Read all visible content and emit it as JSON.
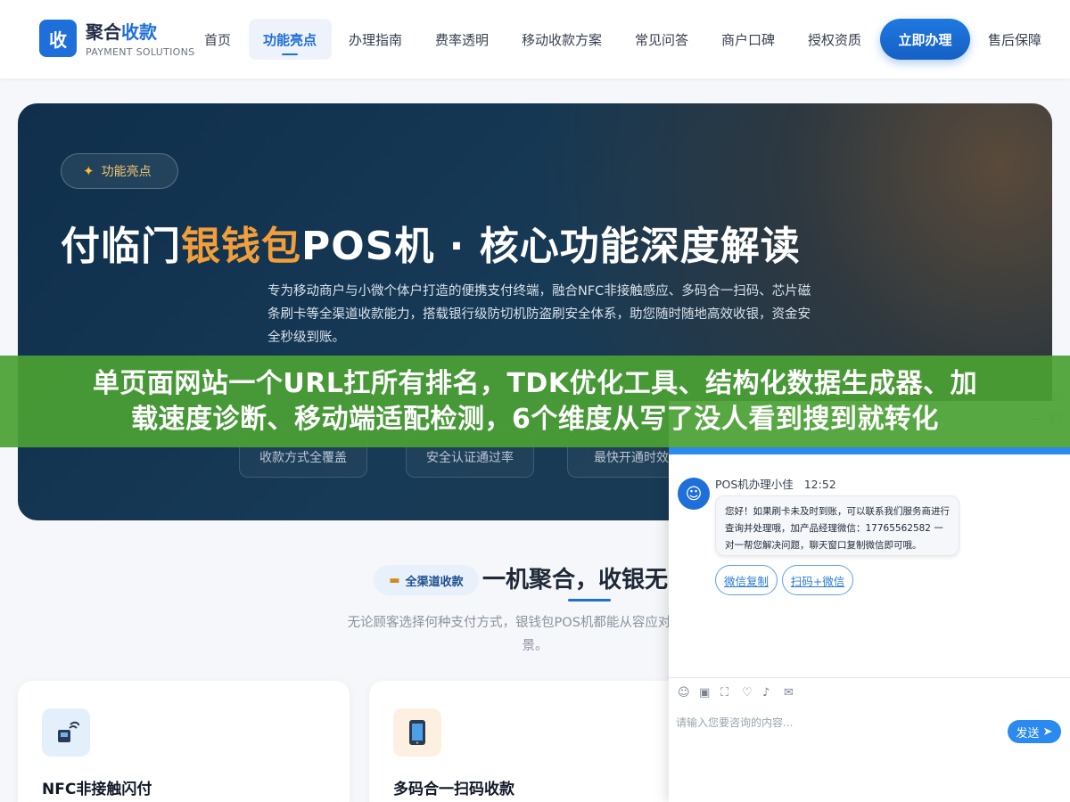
{
  "header": {
    "logo_char": "收",
    "logo_title_a": "聚合",
    "logo_title_b": "收款",
    "logo_sub": "PAYMENT SOLUTIONS",
    "nav": [
      "首页",
      "功能亮点",
      "办理指南",
      "费率透明",
      "移动收款方案",
      "常见问答",
      "商户口碑",
      "授权资质"
    ],
    "cta": "立即办理",
    "after_sales": "售后保障"
  },
  "hero": {
    "badge_icon": "sparkle-icon",
    "badge": "功能亮点",
    "title_a": "付临门",
    "title_hl": "银钱包",
    "title_b": "POS机 · 核心功能深度解读",
    "desc": "专为移动商户与小微个体户打造的便携支付终端，融合NFC非接触感应、多码合一扫码、芯片磁条刷卡等全渠道收款能力，搭载银行级防切机防盗刷安全体系，助您随时随地高效收银，资金安全秒级到账。",
    "stats": [
      "收款方式全覆盖",
      "安全认证通过率",
      "最快开通时效"
    ]
  },
  "banner": {
    "line1": "单页面网站一个URL扛所有排名，TDK优化工具、结构化数据生成器、加",
    "line2": "载速度诊断、移动端适配检测，6个维度从写了没人看到搜到就转化"
  },
  "section": {
    "badge": "全渠道收款",
    "title": "一机聚合，收银无",
    "desc": "无论顾客选择何种支付方式，银钱包POS机都能从容应对，覆盖当",
    "desc_tail": "景。",
    "cards": [
      {
        "title": "NFC非接触闪付",
        "icon": "nfc-terminal-icon",
        "bg": "#e3effb"
      },
      {
        "title": "多码合一扫码收款",
        "icon": "phone-icon",
        "bg": "#fdf0e1"
      }
    ]
  },
  "chat": {
    "agent_name": "POS机办理小佳",
    "time": "12:52",
    "message": "您好！如果刷卡未及时到账，可以联系我们服务商进行查询并处理哦，加产品经理微信：17765562582 一对一帮您解决问题，聊天窗口复制微信即可哦。",
    "quick_replies": [
      "微信复制",
      "扫码+微信"
    ],
    "input_placeholder": "请输入您要咨询的内容...",
    "send": "发送",
    "accent": "#2a8af0"
  }
}
